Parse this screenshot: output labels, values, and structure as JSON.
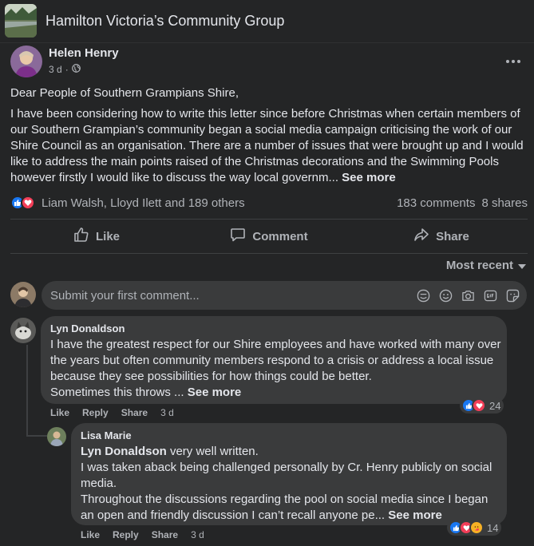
{
  "group": {
    "title": "Hamilton Victoria’s Community Group"
  },
  "post": {
    "author": "Helen Henry",
    "time": "3 d",
    "privacy_icon": "globe-icon",
    "more_icon": "more-icon",
    "greeting": "Dear People of Southern Grampians Shire,",
    "body_lines": [
      "I have been considering how to write this letter since before Christmas when certain members of",
      "our Southern Grampian’s community began a social media campaign criticising the work of our",
      "Shire Council as an organisation.  There are a number of issues that were brought up and I would",
      "like to address the main points raised of the Christmas decorations and the Swimming Pools",
      "however firstly I would like to discuss the way local governm..."
    ],
    "see_more": "See more",
    "reaction_summary": "Liam Walsh, Lloyd Ilett and 189 others",
    "comments_count": "183 comments",
    "shares_count": "8 shares"
  },
  "actions": {
    "like": "Like",
    "comment": "Comment",
    "share": "Share"
  },
  "sort": {
    "label": "Most recent"
  },
  "composer": {
    "placeholder": "Submit your first comment..."
  },
  "comments": [
    {
      "author": "Lyn Donaldson",
      "lines": [
        "I have the greatest respect for our Shire employees and have worked with many over",
        "the years but often community members respond to a crisis or address a local issue",
        "because they see possibilities for how things could be better.",
        "Sometimes this throws ..."
      ],
      "see_more": "See more",
      "like": "Like",
      "reply": "Reply",
      "share": "Share",
      "time": "3 d",
      "reaction_count": "24"
    },
    {
      "author": "Lisa Marie",
      "mention": "Lyn Donaldson",
      "first_line_rest": " very well written.",
      "lines": [
        "I was taken aback being challenged personally by Cr. Henry publicly on social",
        "media.",
        "Throughout the discussions regarding the pool on social media since I began",
        "an open and friendly discussion I can’t recall anyone pe..."
      ],
      "see_more": "See more",
      "like": "Like",
      "reply": "Reply",
      "share": "Share",
      "time": "3 d",
      "reaction_count": "14"
    }
  ],
  "colors": {
    "like_blue": "#1877f2",
    "love_red": "#f33e58",
    "care_yellow": "#f7b125"
  }
}
